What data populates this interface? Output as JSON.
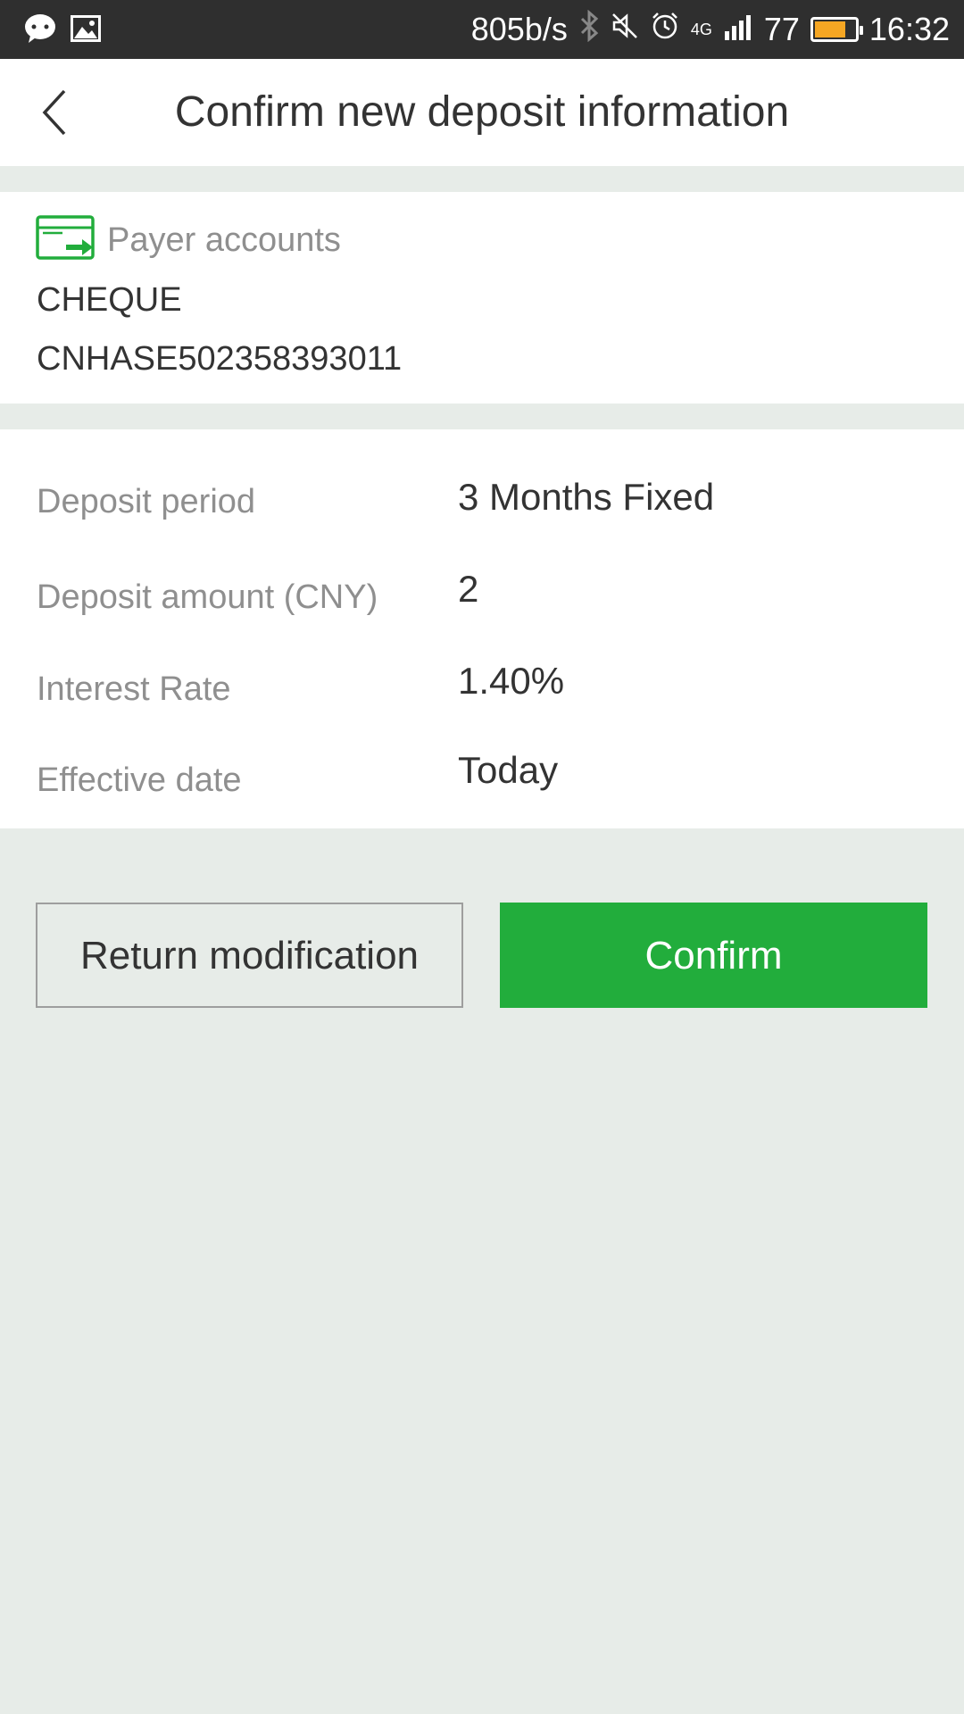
{
  "status_bar": {
    "net_speed": "805b/s",
    "network_type": "4G",
    "battery_level": "77",
    "time": "16:32",
    "icons": [
      "chat-icon",
      "image-icon",
      "bluetooth-icon",
      "mute-icon",
      "alarm-icon",
      "signal-icon",
      "battery-icon"
    ]
  },
  "header": {
    "title": "Confirm new deposit information"
  },
  "payer": {
    "title": "Payer accounts",
    "account_type": "CHEQUE",
    "account_number": "CNHASE502358393011"
  },
  "details": [
    {
      "label": "Deposit period",
      "value": "3 Months Fixed"
    },
    {
      "label": "Deposit amount (CNY)",
      "value": "2"
    },
    {
      "label": "Interest Rate",
      "value": "1.40%"
    },
    {
      "label": "Effective date",
      "value": "Today"
    }
  ],
  "actions": {
    "return_label": "Return modification",
    "confirm_label": "Confirm"
  },
  "colors": {
    "accent": "#22ad3c",
    "background": "#e7ece8",
    "status_bar": "#2f2f2f"
  }
}
